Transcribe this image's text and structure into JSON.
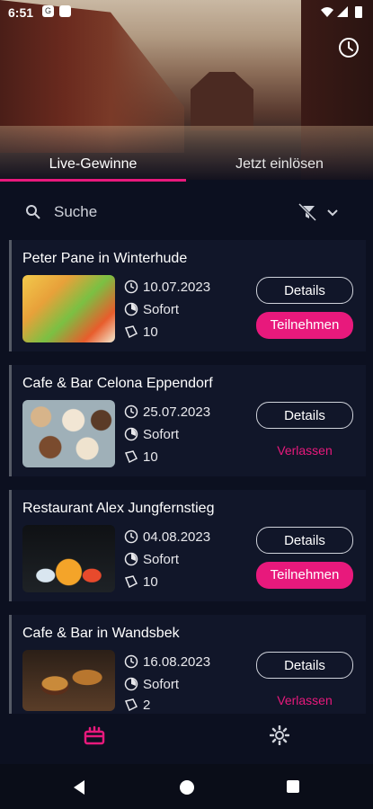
{
  "status_bar": {
    "time": "6:51"
  },
  "tabs": [
    {
      "label": "Live-Gewinne"
    },
    {
      "label": "Jetzt einlösen"
    }
  ],
  "search": {
    "placeholder": "Suche"
  },
  "cards": [
    {
      "title": "Peter Pane in Winterhude",
      "date": "10.07.2023",
      "availability": "Sofort",
      "count": "10",
      "details_label": "Details",
      "action_label": "Teilnehmen",
      "action_type": "join"
    },
    {
      "title": "Cafe & Bar Celona Eppendorf",
      "date": "25.07.2023",
      "availability": "Sofort",
      "count": "10",
      "details_label": "Details",
      "action_label": "Verlassen",
      "action_type": "leave"
    },
    {
      "title": "Restaurant Alex Jungfernstieg",
      "date": "04.08.2023",
      "availability": "Sofort",
      "count": "10",
      "details_label": "Details",
      "action_label": "Teilnehmen",
      "action_type": "join"
    },
    {
      "title": "Cafe & Bar in Wandsbek",
      "date": "16.08.2023",
      "availability": "Sofort",
      "count": "2",
      "details_label": "Details",
      "action_label": "Verlassen",
      "action_type": "leave"
    }
  ],
  "colors": {
    "accent": "#e8197c",
    "background": "#0c1020",
    "card": "#111629"
  },
  "icons": {
    "history": "history-icon",
    "filter_off": "filter-off-icon",
    "gifts_tab": "gift-icon",
    "settings": "gear-icon"
  }
}
